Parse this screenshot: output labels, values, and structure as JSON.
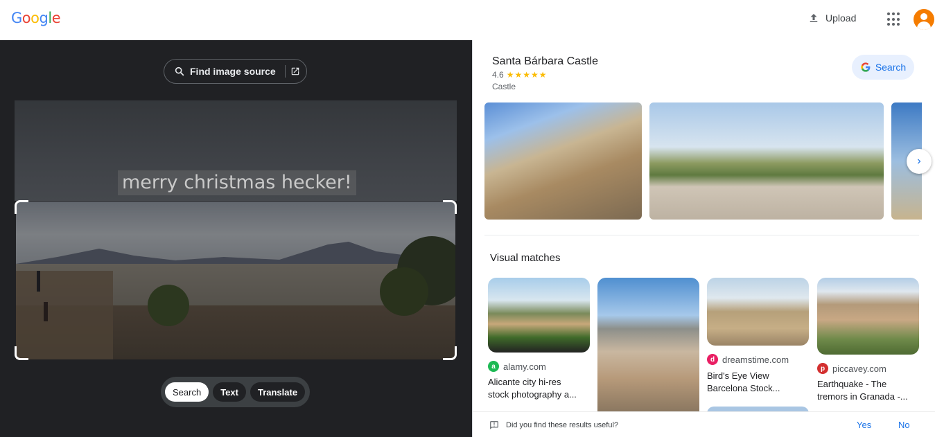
{
  "header": {
    "logo_letters": [
      {
        "ch": "G",
        "color": "#4285F4"
      },
      {
        "ch": "o",
        "color": "#EA4335"
      },
      {
        "ch": "o",
        "color": "#FBBC05"
      },
      {
        "ch": "g",
        "color": "#4285F4"
      },
      {
        "ch": "l",
        "color": "#34A853"
      },
      {
        "ch": "e",
        "color": "#EA4335"
      }
    ],
    "upload_label": "Upload",
    "apps_icon": "apps-grid-icon",
    "avatar_color": "#F57C00"
  },
  "left_panel": {
    "find_source_label": "Find image source",
    "overlay_text": "merry christmas hecker!",
    "modes": [
      {
        "label": "Search",
        "active": true
      },
      {
        "label": "Text",
        "active": false
      },
      {
        "label": "Translate",
        "active": false
      }
    ]
  },
  "knowledge_panel": {
    "title": "Santa Bárbara Castle",
    "rating": "4.6",
    "stars": "★★★★★",
    "type": "Castle",
    "search_label": "Search"
  },
  "visual_matches": {
    "heading": "Visual matches",
    "items": [
      {
        "source": "alamy.com",
        "caption_line1": "Alicante city hi-res",
        "caption_line2": "stock photography a...",
        "favicon_color": "#1DB954",
        "favicon_letter": "a"
      },
      {
        "source": "",
        "caption_line1": "",
        "caption_line2": ""
      },
      {
        "source": "dreamstime.com",
        "caption_line1": "Bird's Eye View",
        "caption_line2": "Barcelona Stock...",
        "favicon_color": "#E91E63",
        "favicon_letter": "d"
      },
      {
        "source": "piccavey.com",
        "caption_line1": "Earthquake - The",
        "caption_line2": "tremors in Granada -...",
        "favicon_color": "#D32F2F",
        "favicon_letter": "p"
      }
    ]
  },
  "feedback": {
    "question": "Did you find these results useful?",
    "yes": "Yes",
    "no": "No"
  }
}
